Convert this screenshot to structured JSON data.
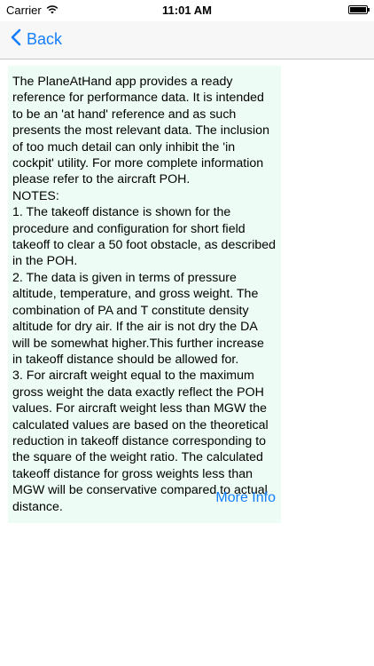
{
  "status_bar": {
    "carrier": "Carrier",
    "time": "11:01 AM",
    "wifi_icon": "wifi-icon",
    "battery_icon": "battery-icon"
  },
  "nav": {
    "back_label": "Back",
    "back_icon": "chevron-left-icon"
  },
  "content": {
    "text": "The PlaneAtHand app provides a ready reference for performance data. It is intended to be an 'at hand' reference and as such presents the most relevant data. The inclusion of too much detail can only inhibit the 'in cockpit' utility. For more complete information please refer to the aircraft POH.\nNOTES:\n1. The takeoff distance is shown for the procedure and configuration for short field takeoff to clear a 50 foot obstacle, as described in the POH.\n2. The data is given in terms of pressure altitude, temperature, and gross weight. The combination of PA and T constitute density altitude for dry air. If the air is not dry the DA will be somewhat higher.This further increase in takeoff distance should be allowed for.\n3. For aircraft weight equal to the maximum gross weight the data exactly reflect the POH values. For aircraft weight less than MGW the calculated values are based on the theoretical reduction in takeoff distance corresponding to the square of the weight ratio. The calculated takeoff distance for gross weights less than MGW will be conservative compared to actual distance.",
    "more_info_label": "More Info"
  },
  "colors": {
    "accent": "#147efb",
    "info_background": "#edfdf6"
  }
}
